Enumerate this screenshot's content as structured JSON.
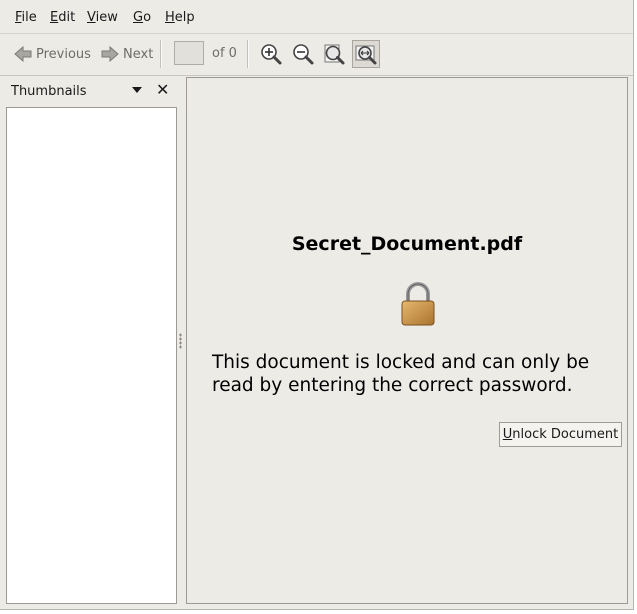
{
  "menu": {
    "items": [
      {
        "mnemonic": "F",
        "rest": "ile"
      },
      {
        "mnemonic": "E",
        "rest": "dit"
      },
      {
        "mnemonic": "V",
        "rest": "iew"
      },
      {
        "mnemonic": "G",
        "rest": "o"
      },
      {
        "mnemonic": "H",
        "rest": "elp"
      }
    ]
  },
  "toolbar": {
    "previous_label": "Previous",
    "next_label": "Next",
    "page_value": "",
    "of_label": "of 0",
    "zoom_icons": [
      "zoom-in-icon",
      "zoom-out-icon",
      "best-fit-icon",
      "fit-width-icon"
    ]
  },
  "sidebar": {
    "title": "Thumbnails",
    "close_glyph": "✕"
  },
  "document": {
    "filename": "Secret_Document.pdf",
    "message_line1": "This document is locked and can only be",
    "message_line2": "read by entering the correct password.",
    "unlock_mnemonic": "U",
    "unlock_rest": "nlock Document"
  },
  "colors": {
    "window_bg": "#edebe6",
    "lock_gold": "#c9954a",
    "lock_shackle": "#8e8e8e"
  }
}
